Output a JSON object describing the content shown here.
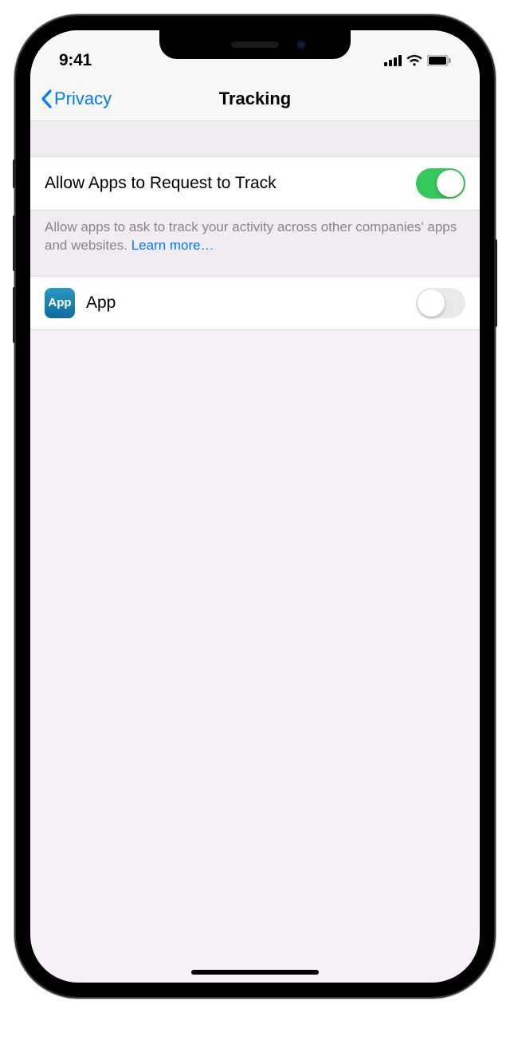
{
  "status": {
    "time": "9:41"
  },
  "nav": {
    "back_label": "Privacy",
    "title": "Tracking"
  },
  "allow_tracking": {
    "label": "Allow Apps to Request to Track",
    "on": true
  },
  "footer": {
    "text": "Allow apps to ask to track your activity across other companies' apps and websites. ",
    "link": "Learn more…"
  },
  "app_row": {
    "icon_text": "App",
    "label": "App",
    "on": false
  }
}
